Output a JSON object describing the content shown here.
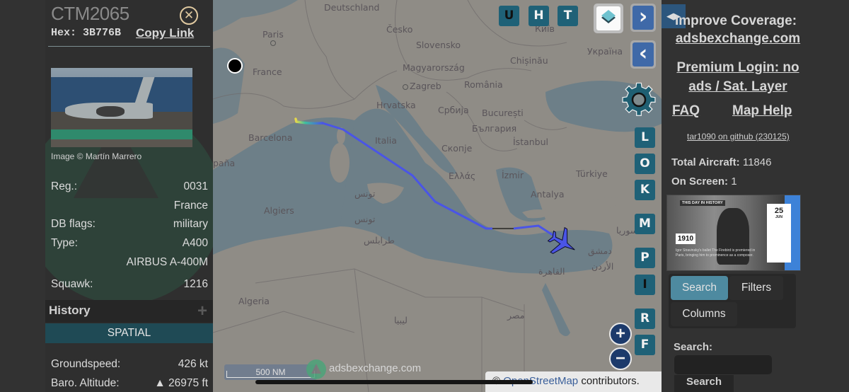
{
  "aircraft": {
    "callsign": "CTM2065",
    "hex_label": "Hex:",
    "hex": "3B776B",
    "copy_link": "Copy Link",
    "photo_credit": "Image © Martín Marrero",
    "details": [
      {
        "key": "Reg.:",
        "value": "0031"
      },
      {
        "key": "",
        "value": "France"
      },
      {
        "key": "DB flags:",
        "value": "military"
      },
      {
        "key": "Type:",
        "value": "A400"
      },
      {
        "key": "",
        "value": "AIRBUS A-400M"
      },
      {
        "key": "Squawk:",
        "value": "1216"
      }
    ],
    "history_label": "History",
    "history_expand": "+",
    "spatial_label": "SPATIAL",
    "spatial": [
      {
        "key": "Groundspeed:",
        "value": "426 kt"
      },
      {
        "key": "Baro. Altitude:",
        "value": "▲ 26975 ft"
      }
    ]
  },
  "map": {
    "labels": {
      "deutschland": "Deutschland",
      "cesko": "Česko",
      "slovensko": "Slovensko",
      "paris": "Paris",
      "france": "France",
      "magyarorszag": "Magyarország",
      "chisinau": "Chișinău",
      "kyiv": "Київ",
      "ukraina": "Україна",
      "zagreb": "Zagreb",
      "romania": "România",
      "hrvatska": "Hrvatska",
      "srbija": "Србија",
      "bucuresti": "București",
      "barcelona": "Barcelona",
      "italia": "Italia",
      "bulgaria": "България",
      "espana": "paña",
      "skopje": "Скопје",
      "istanbul": "İstanbul",
      "ellas": "Ελλάς",
      "izmir": "İzmir",
      "turkiye": "Türkiye",
      "tunis1": "تونس",
      "antalya": "Antalya",
      "algiers": "Algiers",
      "tunis2": "تونس",
      "tarabulus": "طرابلس",
      "suriya": "سوريا",
      "dimashq": "دمشق",
      "alurdun": "الأردن",
      "alqahira": "القاهرة",
      "algeria": "Algeria",
      "libya": "ليبيا",
      "misr": "مصر"
    },
    "buttons": {
      "u": "U",
      "h": "H",
      "t": "T",
      "l": "L",
      "o": "O",
      "k": "K",
      "m": "M",
      "p": "P",
      "i": "I",
      "r": "R",
      "f": "F",
      "next": "›",
      "prev": "‹",
      "zoom_in": "+",
      "zoom_out": "−"
    },
    "scale_label": "500 NM",
    "watermark": "adsbexchange.com",
    "attribution_prefix": "©",
    "attribution_link": "OpenStreetMap",
    "attribution_suffix": "contributors.",
    "track_colors": {
      "start": "#e8d84a",
      "mid": "#3fbf9f",
      "main": "#4a55e6"
    }
  },
  "sidebar": {
    "toggle": "◀▶",
    "improve_line1": "Improve Coverage:",
    "improve_line2": "adsbexchange.com",
    "premium_line1": "Premium Login: no",
    "premium_line2": "ads / Sat. Layer",
    "faq": "FAQ",
    "map_help": "Map Help",
    "github": "tar1090 on github (230125)",
    "total_label": "Total Aircraft:",
    "total_value": "11846",
    "onscreen_label": "On Screen:",
    "onscreen_value": "1",
    "ad": {
      "tag": "THIS DAY IN HISTORY",
      "day": "25",
      "month": "JUN",
      "year": "1910",
      "caption": "Igor Stravinsky's ballet The Firebird is premiered in Paris, bringing him to prominence as a composer."
    },
    "tabs": [
      {
        "label": "Search",
        "active": true
      },
      {
        "label": "Filters",
        "active": false
      },
      {
        "label": "Columns",
        "active": false
      }
    ],
    "search_label": "Search:",
    "search_value": "",
    "search_button": "Search"
  }
}
